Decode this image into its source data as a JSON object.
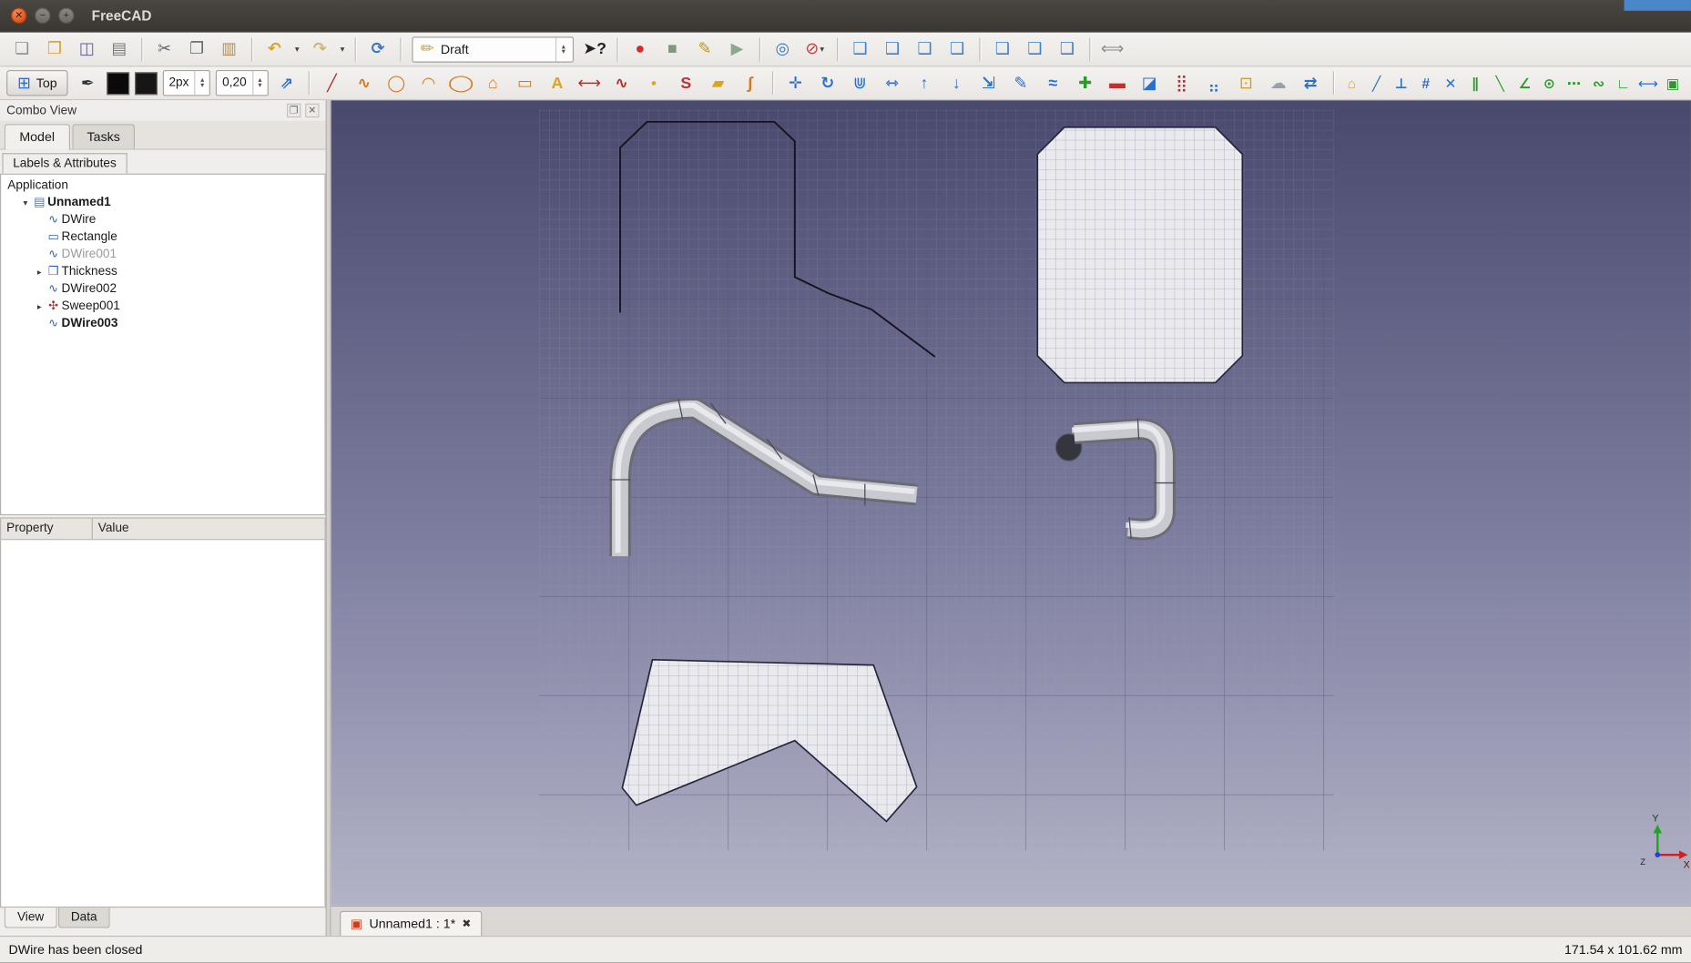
{
  "window": {
    "title": "FreeCAD",
    "controls": [
      {
        "name": "close",
        "glyph": "✕"
      },
      {
        "name": "minimize",
        "glyph": "−"
      },
      {
        "name": "maximize",
        "glyph": "+"
      }
    ]
  },
  "icons": {
    "close": "✕",
    "float": "❐",
    "tab_close": "✖",
    "dropdown": "▾",
    "spin_up": "▴",
    "spin_down": "▾",
    "doc": "▣"
  },
  "toolbar_standard": {
    "items": [
      {
        "name": "new-file",
        "glyph": "❏",
        "color": "#8f8f8f"
      },
      {
        "name": "open-file",
        "glyph": "❒",
        "color": "#d89c28"
      },
      {
        "name": "save-file",
        "glyph": "◫",
        "color": "#6a5aa8"
      },
      {
        "name": "print",
        "glyph": "▤",
        "color": "#787878"
      },
      {
        "type": "sep"
      },
      {
        "name": "cut",
        "glyph": "✂",
        "color": "#666666"
      },
      {
        "name": "copy",
        "glyph": "❐",
        "color": "#666666"
      },
      {
        "name": "paste",
        "glyph": "▥",
        "color": "#b08d57"
      },
      {
        "type": "sep"
      },
      {
        "name": "undo",
        "glyph": "↶",
        "color": "#d9a520",
        "bold": true
      },
      {
        "type": "dd",
        "name": "undo-history-dropdown"
      },
      {
        "name": "redo",
        "glyph": "↷",
        "color": "#c9b878",
        "bold": true
      },
      {
        "type": "dd",
        "name": "redo-history-dropdown"
      },
      {
        "type": "sep"
      },
      {
        "name": "refresh",
        "glyph": "⟳",
        "color": "#3a76c4",
        "bold": true
      },
      {
        "type": "sep"
      },
      {
        "type": "select",
        "name": "workbench-selector",
        "glyph": "✏",
        "color": "#c8a030",
        "value": "Draft"
      },
      {
        "name": "whats-this",
        "glyph": "➤?",
        "color": "#222222",
        "bold": true
      },
      {
        "type": "sep"
      },
      {
        "name": "macro-record",
        "glyph": "●",
        "color": "#d42a2a"
      },
      {
        "name": "macro-stop",
        "glyph": "■",
        "color": "#7d9a7d"
      },
      {
        "name": "macro-edit",
        "glyph": "✎",
        "color": "#b8962a"
      },
      {
        "name": "macro-execute",
        "glyph": "▶",
        "color": "#8aa88a"
      },
      {
        "type": "sep"
      },
      {
        "name": "fit-all",
        "glyph": "◎",
        "color": "#3a76c4"
      },
      {
        "name": "draw-style",
        "glyph": "⊘",
        "color": "#c43a3a",
        "dd": true
      },
      {
        "type": "sep"
      },
      {
        "name": "view-axonometric",
        "glyph": "❑",
        "color": "#3a80c8"
      },
      {
        "name": "view-front",
        "glyph": "❑",
        "color": "#3a80c8"
      },
      {
        "name": "view-top",
        "glyph": "❑",
        "color": "#3a80c8"
      },
      {
        "name": "view-right",
        "glyph": "❑",
        "color": "#3a80c8"
      },
      {
        "type": "sep"
      },
      {
        "name": "view-rear",
        "glyph": "❑",
        "color": "#3a80c8"
      },
      {
        "name": "view-bottom",
        "glyph": "❑",
        "color": "#3a80c8"
      },
      {
        "name": "view-left",
        "glyph": "❑",
        "color": "#3a80c8"
      },
      {
        "type": "sep"
      },
      {
        "name": "measure-distance",
        "glyph": "⟺",
        "color": "#888888"
      }
    ]
  },
  "toolbar_draft": {
    "items": [
      {
        "type": "plane",
        "name": "working-plane-button",
        "glyph": "⊞",
        "color": "#2a6fd0",
        "label": "Top"
      },
      {
        "type": "button",
        "name": "construction-mode-toggle",
        "glyph": "✒",
        "color": "#333333"
      },
      {
        "type": "swatch",
        "name": "line-color-swatch",
        "color": "#0a0a0a"
      },
      {
        "type": "swatch",
        "name": "face-color-swatch",
        "color": "#161616"
      },
      {
        "type": "spinner",
        "name": "line-width-spinner",
        "value": "2px"
      },
      {
        "type": "spinner",
        "name": "text-scale-spinner",
        "value": "0,20"
      },
      {
        "type": "button",
        "name": "apply-style-button",
        "glyph": "⇗",
        "color": "#2a6fd0",
        "bold": true
      },
      {
        "type": "sep"
      },
      {
        "name": "draft-line",
        "glyph": "╱",
        "color": "#b03030",
        "bold": true
      },
      {
        "name": "draft-wire",
        "glyph": "∿",
        "color": "#d07820",
        "bold": true
      },
      {
        "name": "draft-circle",
        "glyph": "◯",
        "color": "#d07820"
      },
      {
        "name": "draft-arc",
        "glyph": "◠",
        "color": "#d07820",
        "bold": true
      },
      {
        "name": "draft-ellipse",
        "glyph": "◯",
        "color": "#d07820",
        "stretch": true
      },
      {
        "name": "draft-polygon",
        "glyph": "⌂",
        "color": "#d07820",
        "bold": true
      },
      {
        "name": "draft-rectangle",
        "glyph": "▭",
        "color": "#d07820"
      },
      {
        "name": "draft-text",
        "glyph": "A",
        "color": "#d9a520",
        "bold": true
      },
      {
        "name": "draft-dimension",
        "glyph": "⟷",
        "color": "#b03030"
      },
      {
        "name": "draft-bspline",
        "glyph": "∿",
        "color": "#b03030",
        "bold": true
      },
      {
        "name": "draft-point",
        "glyph": "●",
        "color": "#d9a520",
        "small": true
      },
      {
        "name": "draft-shapestring",
        "glyph": "S",
        "color": "#c03030",
        "bold": true
      },
      {
        "name": "draft-facebinder",
        "glyph": "▰",
        "color": "#d9a520"
      },
      {
        "name": "draft-bezcurve",
        "glyph": "∫",
        "color": "#d07820",
        "bold": true
      },
      {
        "type": "sep"
      },
      {
        "name": "draft-move",
        "glyph": "✛",
        "color": "#2a6fd0",
        "bold": true
      },
      {
        "name": "draft-rotate",
        "glyph": "↻",
        "color": "#2a6fd0",
        "bold": true
      },
      {
        "name": "draft-offset",
        "glyph": "⋓",
        "color": "#2a6fd0"
      },
      {
        "name": "draft-trimex",
        "glyph": "⇿",
        "color": "#2a6fd0",
        "bold": true
      },
      {
        "name": "draft-upgrade",
        "glyph": "↑",
        "color": "#2a6fd0",
        "bold": true
      },
      {
        "name": "draft-downgrade",
        "glyph": "↓",
        "color": "#2a6fd0",
        "bold": true
      },
      {
        "name": "draft-scale",
        "glyph": "⇲",
        "color": "#2a6fd0",
        "bold": true
      },
      {
        "name": "draft-edit",
        "glyph": "✎",
        "color": "#2a6fd0"
      },
      {
        "name": "draft-wire-to-bspline",
        "glyph": "≈",
        "color": "#2a6fd0",
        "bold": true
      },
      {
        "name": "draft-add-point",
        "glyph": "✚",
        "color": "#2a9a2a"
      },
      {
        "name": "draft-delete-point",
        "glyph": "▬",
        "color": "#c03030"
      },
      {
        "name": "draft-shape2dview",
        "glyph": "◪",
        "color": "#2a6fd0"
      },
      {
        "name": "draft-array",
        "glyph": "⣿",
        "color": "#b03030"
      },
      {
        "name": "draft-patharray",
        "glyph": "⣤",
        "color": "#2a6fd0"
      },
      {
        "name": "draft-drawing",
        "glyph": "⊡",
        "color": "#c8a030"
      },
      {
        "name": "draft-clone",
        "glyph": "☁",
        "color": "#9aa0a8",
        "bold": true
      },
      {
        "name": "draft-heal",
        "glyph": "⇄",
        "color": "#2a6fd0",
        "bold": true
      },
      {
        "type": "sep"
      },
      {
        "name": "snap-lock",
        "glyph": "⌂",
        "color": "#d9a520",
        "narrow": true,
        "bold": true
      },
      {
        "name": "snap-midpoint",
        "glyph": "╱",
        "color": "#2a6fd0",
        "narrow": true,
        "bold": true
      },
      {
        "name": "snap-perpendicular",
        "glyph": "⊥",
        "color": "#2a6fd0",
        "narrow": true,
        "bold": true
      },
      {
        "name": "snap-grid",
        "glyph": "#",
        "color": "#2a6fd0",
        "narrow": true,
        "bold": true
      },
      {
        "name": "snap-intersection",
        "glyph": "✕",
        "color": "#2a6fd0",
        "narrow": true,
        "bold": true
      },
      {
        "name": "snap-parallel",
        "glyph": "∥",
        "color": "#2a9a2a",
        "narrow": true,
        "bold": true
      },
      {
        "name": "snap-endpoint",
        "glyph": "╲",
        "color": "#2a9a2a",
        "narrow": true,
        "bold": true
      },
      {
        "name": "snap-angle",
        "glyph": "∠",
        "color": "#2a9a2a",
        "narrow": true,
        "bold": true
      },
      {
        "name": "snap-center",
        "glyph": "⊙",
        "color": "#2a9a2a",
        "narrow": true,
        "bold": true
      },
      {
        "name": "snap-extension",
        "glyph": "⋯",
        "color": "#2a9a2a",
        "narrow": true,
        "bold": true
      },
      {
        "name": "snap-near",
        "glyph": "∾",
        "color": "#2a9a2a",
        "narrow": true,
        "bold": true
      },
      {
        "name": "snap-ortho",
        "glyph": "∟",
        "color": "#2a9a2a",
        "narrow": true,
        "bold": true
      },
      {
        "name": "snap-dimensions",
        "glyph": "⟷",
        "color": "#2a6fd0",
        "narrow": true
      },
      {
        "name": "snap-working-plane",
        "glyph": "▣",
        "color": "#2a9a2a",
        "narrow": true
      }
    ]
  },
  "combo": {
    "title": "Combo View",
    "tabs": [
      {
        "label": "Model",
        "active": true
      },
      {
        "label": "Tasks",
        "active": false
      }
    ],
    "tree_tab": "Labels & Attributes",
    "tree_root": "Application",
    "tree": [
      {
        "label": "Unnamed1",
        "icon": "document",
        "arrow": "down",
        "indent": 1,
        "bold": true
      },
      {
        "label": "DWire",
        "icon": "wire",
        "indent": 2
      },
      {
        "label": "Rectangle",
        "icon": "rectangle",
        "indent": 2
      },
      {
        "label": "DWire001",
        "icon": "wire",
        "indent": 2,
        "disabled": true
      },
      {
        "label": "Thickness",
        "icon": "thickness",
        "arrow": "right",
        "indent": 2
      },
      {
        "label": "DWire002",
        "icon": "wire",
        "indent": 2
      },
      {
        "label": "Sweep001",
        "icon": "sweep",
        "arrow": "right",
        "indent": 2
      },
      {
        "label": "DWire003",
        "icon": "wire",
        "indent": 2,
        "bold": true
      }
    ],
    "property_col": "Property",
    "value_col": "Value",
    "bottom_tabs": [
      {
        "label": "View",
        "active": true
      },
      {
        "label": "Data",
        "active": false
      }
    ]
  },
  "viewport": {
    "axis": {
      "x": "X",
      "y": "Y",
      "z": "Z"
    }
  },
  "doc_tab": {
    "label": "Unnamed1 : 1*"
  },
  "statusbar": {
    "message": "DWire has been closed",
    "dimensions": "171.54 x 101.62 mm"
  }
}
